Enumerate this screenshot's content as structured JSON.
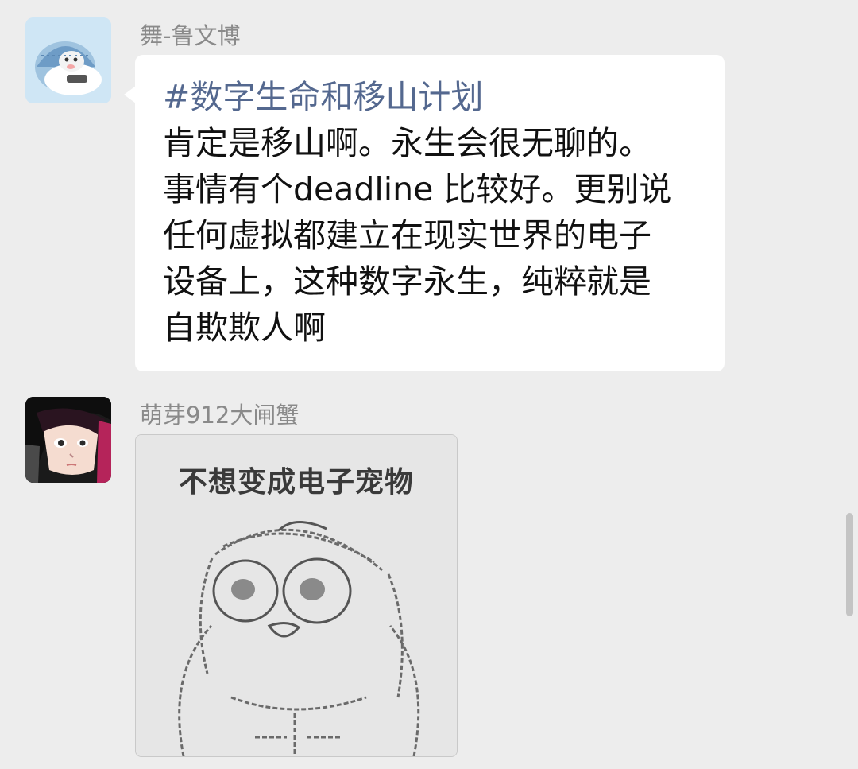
{
  "messages": [
    {
      "sender": "舞-鲁文博",
      "avatar_icon": "cartoon-hamster-avatar",
      "topic": "#数字生命和移山计划",
      "lines": [
        "肯定是移山啊。永生会很无聊的。",
        "事情有个deadline 比较好。更别说",
        "任何虚拟都建立在现实世界的电子",
        "设备上，这种数字永生，纯粹就是",
        "自欺欺人啊"
      ]
    },
    {
      "sender": "萌芽912大闸蟹",
      "avatar_icon": "anime-girl-avatar",
      "sticker_icon": "penguin-meme-sticker",
      "sticker_caption": "不想变成电子宠物"
    }
  ],
  "colors": {
    "background": "#ededed",
    "bubble": "#ffffff",
    "topic_link": "#54688f",
    "sender_name": "#8a8a8a"
  }
}
